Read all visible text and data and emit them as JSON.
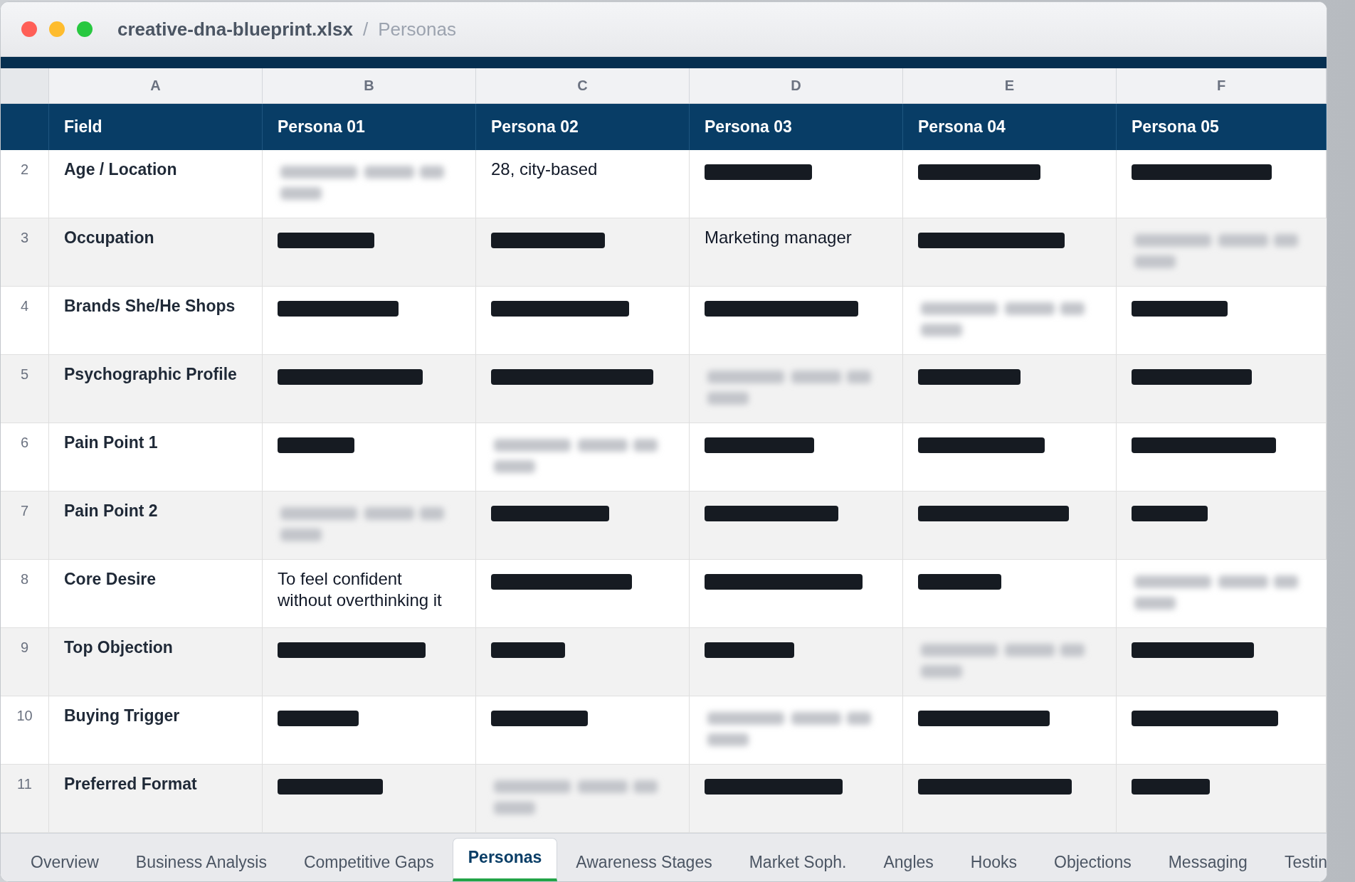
{
  "window": {
    "file_name": "creative-dna-blueprint.xlsx",
    "separator": "/",
    "sheet_name": "Personas"
  },
  "grid": {
    "column_letters": [
      "A",
      "B",
      "C",
      "D",
      "E",
      "F"
    ],
    "header": [
      "Field",
      "Persona 01",
      "Persona 02",
      "Persona 03",
      "Persona 04",
      "Persona 05"
    ],
    "rows": [
      {
        "number": "2",
        "field": "Age / Location",
        "cells": [
          {
            "kind": "blurred"
          },
          {
            "kind": "text",
            "text": "28, city-based"
          },
          {
            "kind": "redacted"
          },
          {
            "kind": "redacted"
          },
          {
            "kind": "redacted"
          }
        ]
      },
      {
        "number": "3",
        "field": "Occupation",
        "cells": [
          {
            "kind": "redacted"
          },
          {
            "kind": "redacted"
          },
          {
            "kind": "text",
            "text": "Marketing manager"
          },
          {
            "kind": "redacted"
          },
          {
            "kind": "blurred"
          }
        ]
      },
      {
        "number": "4",
        "field": "Brands She/He Shops",
        "cells": [
          {
            "kind": "redacted"
          },
          {
            "kind": "redacted"
          },
          {
            "kind": "redacted"
          },
          {
            "kind": "blurred"
          },
          {
            "kind": "redacted"
          }
        ]
      },
      {
        "number": "5",
        "field": "Psychographic Profile",
        "cells": [
          {
            "kind": "redacted"
          },
          {
            "kind": "redacted"
          },
          {
            "kind": "blurred"
          },
          {
            "kind": "redacted"
          },
          {
            "kind": "redacted"
          }
        ]
      },
      {
        "number": "6",
        "field": "Pain Point 1",
        "cells": [
          {
            "kind": "redacted"
          },
          {
            "kind": "blurred"
          },
          {
            "kind": "redacted"
          },
          {
            "kind": "redacted"
          },
          {
            "kind": "redacted"
          }
        ]
      },
      {
        "number": "7",
        "field": "Pain Point 2",
        "cells": [
          {
            "kind": "blurred"
          },
          {
            "kind": "redacted"
          },
          {
            "kind": "redacted"
          },
          {
            "kind": "redacted"
          },
          {
            "kind": "redacted"
          }
        ]
      },
      {
        "number": "8",
        "field": "Core Desire",
        "cells": [
          {
            "kind": "text",
            "text": "To feel confident without overthinking it"
          },
          {
            "kind": "redacted"
          },
          {
            "kind": "redacted"
          },
          {
            "kind": "redacted"
          },
          {
            "kind": "blurred"
          }
        ]
      },
      {
        "number": "9",
        "field": "Top Objection",
        "cells": [
          {
            "kind": "redacted"
          },
          {
            "kind": "redacted"
          },
          {
            "kind": "redacted"
          },
          {
            "kind": "blurred"
          },
          {
            "kind": "redacted"
          }
        ]
      },
      {
        "number": "10",
        "field": "Buying Trigger",
        "cells": [
          {
            "kind": "redacted"
          },
          {
            "kind": "redacted"
          },
          {
            "kind": "blurred"
          },
          {
            "kind": "redacted"
          },
          {
            "kind": "redacted"
          }
        ]
      },
      {
        "number": "11",
        "field": "Preferred Format",
        "cells": [
          {
            "kind": "redacted"
          },
          {
            "kind": "blurred"
          },
          {
            "kind": "redacted"
          },
          {
            "kind": "redacted"
          },
          {
            "kind": "redacted"
          }
        ]
      }
    ]
  },
  "sheet_tabs": [
    {
      "label": "Overview",
      "selected": false
    },
    {
      "label": "Business Analysis",
      "selected": false
    },
    {
      "label": "Competitive Gaps",
      "selected": false
    },
    {
      "label": "Personas",
      "selected": true
    },
    {
      "label": "Awareness Stages",
      "selected": false
    },
    {
      "label": "Market Soph.",
      "selected": false
    },
    {
      "label": "Angles",
      "selected": false
    },
    {
      "label": "Hooks",
      "selected": false
    },
    {
      "label": "Objections",
      "selected": false
    },
    {
      "label": "Messaging",
      "selected": false
    },
    {
      "label": "Testin",
      "selected": false
    }
  ]
}
